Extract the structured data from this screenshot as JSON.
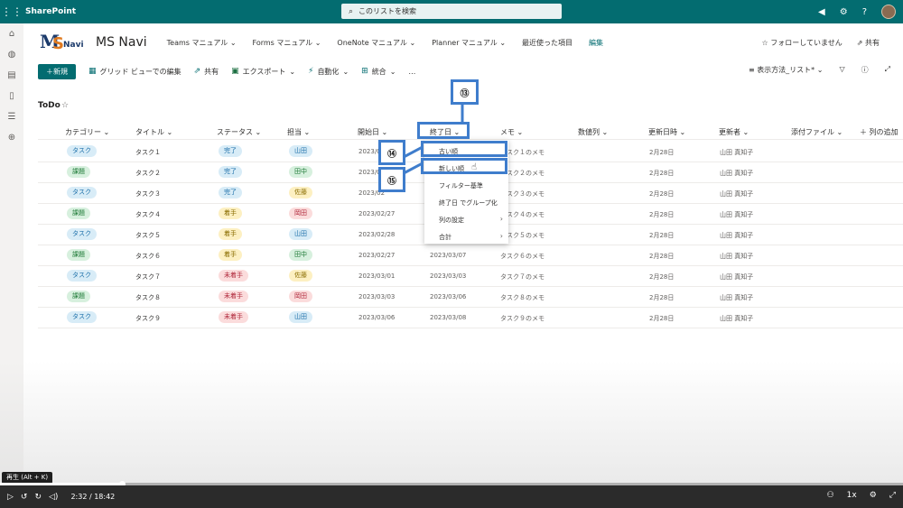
{
  "suitebar": {
    "app_name": "SharePoint",
    "search_placeholder": "このリストを検索"
  },
  "site": {
    "logo_text": "MSNavi",
    "name": "MS Navi",
    "nav": [
      "Teams マニュアル",
      "Forms マニュアル",
      "OneNote マニュアル",
      "Planner マニュアル",
      "最近使った項目"
    ],
    "edit": "編集",
    "follow": "フォローしていません",
    "share": "共有"
  },
  "commandbar": {
    "new": "新規",
    "grid_edit": "グリッド ビューでの編集",
    "share": "共有",
    "export": "エクスポート",
    "automate": "自動化",
    "integrate": "統合",
    "more": "…",
    "view_options": "表示方法_リスト*"
  },
  "list": {
    "title": "ToDo",
    "columns": [
      "カテゴリー",
      "タイトル",
      "ステータス",
      "担当",
      "開始日",
      "終了日",
      "メモ",
      "数値列",
      "更新日時",
      "更新者",
      "添付ファイル",
      "列の追加"
    ],
    "rows": [
      {
        "category": "タスク",
        "title": "タスク１",
        "status": "完了",
        "owner": "山田",
        "start": "2023/02",
        "end": "",
        "memo": "タスク１のメモ",
        "modified": "2月28日",
        "modified_by": "山田 真知子"
      },
      {
        "category": "課題",
        "title": "タスク２",
        "status": "完了",
        "owner": "田中",
        "start": "2023/02",
        "end": "",
        "memo": "タスク２のメモ",
        "modified": "2月28日",
        "modified_by": "山田 真知子"
      },
      {
        "category": "タスク",
        "title": "タスク３",
        "status": "完了",
        "owner": "佐藤",
        "start": "2023/02",
        "end": "",
        "memo": "タスク３のメモ",
        "modified": "2月28日",
        "modified_by": "山田 真知子"
      },
      {
        "category": "課題",
        "title": "タスク４",
        "status": "着手",
        "owner": "岡田",
        "start": "2023/02/27",
        "end": "",
        "memo": "タスク４のメモ",
        "modified": "2月28日",
        "modified_by": "山田 真知子"
      },
      {
        "category": "タスク",
        "title": "タスク５",
        "status": "着手",
        "owner": "山田",
        "start": "2023/02/28",
        "end": "",
        "memo": "タスク５のメモ",
        "modified": "2月28日",
        "modified_by": "山田 真知子"
      },
      {
        "category": "課題",
        "title": "タスク６",
        "status": "着手",
        "owner": "田中",
        "start": "2023/02/27",
        "end": "2023/03/07",
        "memo": "タスク６のメモ",
        "modified": "2月28日",
        "modified_by": "山田 真知子"
      },
      {
        "category": "タスク",
        "title": "タスク７",
        "status": "未着手",
        "owner": "佐藤",
        "start": "2023/03/01",
        "end": "2023/03/03",
        "memo": "タスク７のメモ",
        "modified": "2月28日",
        "modified_by": "山田 真知子"
      },
      {
        "category": "課題",
        "title": "タスク８",
        "status": "未着手",
        "owner": "岡田",
        "start": "2023/03/03",
        "end": "2023/03/06",
        "memo": "タスク８のメモ",
        "modified": "2月28日",
        "modified_by": "山田 真知子"
      },
      {
        "category": "タスク",
        "title": "タスク９",
        "status": "未着手",
        "owner": "山田",
        "start": "2023/03/06",
        "end": "2023/03/08",
        "memo": "タスク９のメモ",
        "modified": "2月28日",
        "modified_by": "山田 真知子"
      }
    ]
  },
  "dropdown": {
    "items": [
      "古い順",
      "新しい順",
      "フィルター基準",
      "終了日 でグループ化",
      "列の設定",
      "合計"
    ]
  },
  "annotations": {
    "a13": "⑬",
    "a14": "⑭",
    "a15": "⑮"
  },
  "player": {
    "tooltip": "再生 (Alt + K)",
    "time": "2:32 / 18:42",
    "speed": "1x",
    "progress_fraction": 0.135
  },
  "colors": {
    "brand": "#036c70",
    "annotation": "#3f7dcc",
    "category_task_bg": "#d8ecf7",
    "category_issue_bg": "#d7f0de",
    "status_done_bg": "#d8ecf7",
    "status_started_bg": "#fdf0c2",
    "status_notstarted_bg": "#fbdcdc"
  }
}
